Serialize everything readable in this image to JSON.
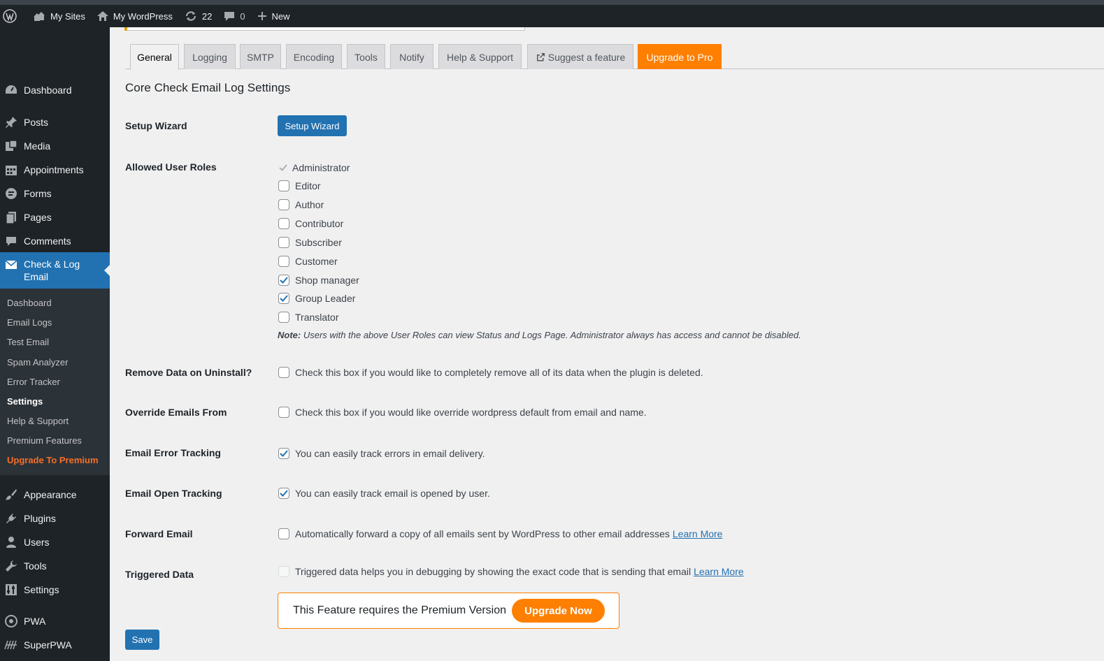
{
  "adminbar": {
    "my_sites": "My Sites",
    "site_name": "My WordPress",
    "updates_count": "22",
    "comments_count": "0",
    "new_label": "New"
  },
  "sidebar": {
    "menu": {
      "dashboard": "Dashboard",
      "posts": "Posts",
      "media": "Media",
      "appointments": "Appointments",
      "forms": "Forms",
      "pages": "Pages",
      "comments": "Comments",
      "check_log_email_1": "Check & Log",
      "check_log_email_2": "Email",
      "appearance": "Appearance",
      "plugins": "Plugins",
      "users": "Users",
      "tools": "Tools",
      "settings": "Settings",
      "pwa": "PWA",
      "superpwa": "SuperPWA"
    },
    "submenu": {
      "dashboard": "Dashboard",
      "email_logs": "Email Logs",
      "test_email": "Test Email",
      "spam_analyzer": "Spam Analyzer",
      "error_tracker": "Error Tracker",
      "settings": "Settings",
      "help_support": "Help & Support",
      "premium_features": "Premium Features",
      "upgrade": "Upgrade To Premium"
    }
  },
  "tabs": {
    "general": "General",
    "logging": "Logging",
    "smtp": "SMTP",
    "encoding": "Encoding",
    "tools": "Tools",
    "notify": "Notify",
    "help": "Help & Support",
    "suggest": "Suggest a feature",
    "upgrade": "Upgrade to Pro"
  },
  "page": {
    "heading": "Core Check Email Log Settings",
    "setup_wizard_label": "Setup Wizard",
    "setup_wizard_button": "Setup Wizard",
    "allowed_roles_label": "Allowed User Roles",
    "roles": {
      "administrator": "Administrator",
      "editor": "Editor",
      "author": "Author",
      "contributor": "Contributor",
      "subscriber": "Subscriber",
      "customer": "Customer",
      "shop_manager": "Shop manager",
      "group_leader": "Group Leader",
      "translator": "Translator"
    },
    "role_checked": {
      "editor": false,
      "author": false,
      "contributor": false,
      "subscriber": false,
      "customer": false,
      "shop_manager": true,
      "group_leader": true,
      "translator": false
    },
    "note_prefix": "Note:",
    "note_text": "Users with the above User Roles can view Status and Logs Page. Administrator always has access and cannot be disabled.",
    "remove_data_label": "Remove Data on Uninstall?",
    "remove_data_desc": "Check this box if you would like to completely remove all of its data when the plugin is deleted.",
    "override_label": "Override Emails From",
    "override_desc": "Check this box if you would like override wordpress default from email and name.",
    "error_tracking_label": "Email Error Tracking",
    "error_tracking_desc": "You can easily track errors in email delivery.",
    "open_tracking_label": "Email Open Tracking",
    "open_tracking_desc": "You can easily track email is opened by user.",
    "forward_label": "Forward Email",
    "forward_desc": "Automatically forward a copy of all emails sent by WordPress to other email addresses",
    "forward_link": "Learn More",
    "triggered_label": "Triggered Data",
    "triggered_desc": "Triggered data helps you in debugging by showing the exact code that is sending that email",
    "triggered_link": "Learn More",
    "premium_text": "This Feature requires the Premium Version",
    "upgrade_now": "Upgrade Now",
    "save": "Save"
  },
  "settings_checked": {
    "remove_data": false,
    "override": false,
    "error_tracking": true,
    "open_tracking": true,
    "forward": false,
    "triggered": false
  },
  "colors": {
    "accent": "#2271b1",
    "pro_orange": "#ff8000",
    "admin_bar": "#1d2327"
  }
}
